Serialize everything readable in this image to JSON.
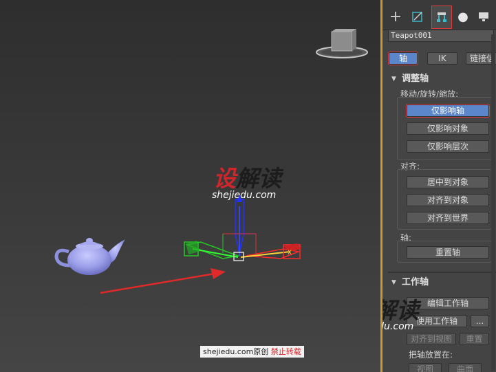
{
  "viewport": {
    "watermark_logo_red": "设",
    "watermark_logo_dark": "解读",
    "watermark_site": "shejiedu.com",
    "credit": {
      "site": "shejiedu.com原创",
      "warning": "禁止转载"
    }
  },
  "panel": {
    "tabs": [
      {
        "icon": "plus-icon",
        "glyph": "+"
      },
      {
        "icon": "modify-icon",
        "glyph": ""
      },
      {
        "icon": "hierarchy-icon",
        "glyph": ""
      },
      {
        "icon": "motion-icon",
        "glyph": "●"
      },
      {
        "icon": "display-icon",
        "glyph": ""
      }
    ],
    "object_name": "Teapot001",
    "mode_buttons": {
      "pivot": "轴",
      "ik": "IK",
      "link": "链接信"
    },
    "adjust_pivot": {
      "title": "调整轴",
      "move_label": "移动/旋转/缩放:",
      "affect_pivot_only": "仅影响轴",
      "affect_object_only": "仅影响对象",
      "affect_hierarchy_only": "仅影响层次",
      "align_label": "对齐:",
      "center_to_object": "居中到对象",
      "align_to_object": "对齐到对象",
      "align_to_world": "对齐到世界",
      "pivot_label": "轴:",
      "reset_pivot": "重置轴"
    },
    "working_pivot": {
      "title": "工作轴",
      "edit_working_pivot": "编辑工作轴",
      "use_working_pivot": "使用工作轴",
      "more": "...",
      "align_to_view": "对齐到视图",
      "reset": "重置",
      "place_pivot_label": "把轴放置在:",
      "view": "视图",
      "surface": "曲面"
    }
  },
  "colors": {
    "accent_blue": "#5b86c9",
    "highlight_red": "#e0393e",
    "teapot": "#9b9ee8",
    "viewport_border": "#c89b2a"
  }
}
